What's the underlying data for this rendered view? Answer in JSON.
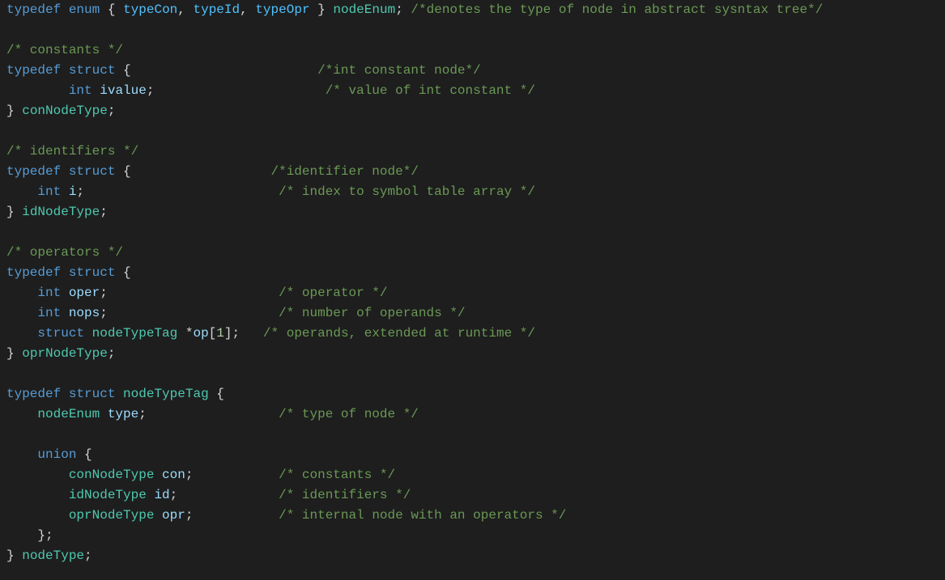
{
  "l0": {
    "kw1": "typedef",
    "kw2": "enum",
    "b1": "{",
    "e1": "typeCon",
    "c1": ",",
    "e2": "typeId",
    "c2": ",",
    "e3": "typeOpr",
    "b2": "}",
    "name": "nodeEnum",
    "sc": ";",
    "cm": "/*denotes the type of node in abstract sysntax tree*/"
  },
  "l1": "",
  "l2": {
    "cm": "/* constants */"
  },
  "l3": {
    "kw1": "typedef",
    "kw2": "struct",
    "b": "{",
    "cm": "/*int constant node*/"
  },
  "l4": {
    "kw": "int",
    "id": "ivalue",
    "sc": ";",
    "cm": "/* value of int constant */"
  },
  "l5": {
    "b": "}",
    "name": "conNodeType",
    "sc": ";"
  },
  "l6": "",
  "l7": {
    "cm": "/* identifiers */"
  },
  "l8": {
    "kw1": "typedef",
    "kw2": "struct",
    "b": "{",
    "cm": "/*identifier node*/"
  },
  "l9": {
    "kw": "int",
    "id": "i",
    "sc": ";",
    "cm": "/* index to symbol table array */"
  },
  "l10": {
    "b": "}",
    "name": "idNodeType",
    "sc": ";"
  },
  "l11": "",
  "l12": {
    "cm": "/* operators */"
  },
  "l13": {
    "kw1": "typedef",
    "kw2": "struct",
    "b": "{"
  },
  "l14": {
    "kw": "int",
    "id": "oper",
    "sc": ";",
    "cm": "/* operator */"
  },
  "l15": {
    "kw": "int",
    "id": "nops",
    "sc": ";",
    "cm": "/* number of operands */"
  },
  "l16": {
    "kw": "struct",
    "tag": "nodeTypeTag",
    "star": "*",
    "id": "op",
    "lb": "[",
    "n": "1",
    "rb": "]",
    "sc": ";",
    "cm": "/* operands, extended at runtime */"
  },
  "l17": {
    "b": "}",
    "name": "oprNodeType",
    "sc": ";"
  },
  "l18": "",
  "l19": {
    "kw1": "typedef",
    "kw2": "struct",
    "tag": "nodeTypeTag",
    "b": "{"
  },
  "l20": {
    "type": "nodeEnum",
    "id": "type",
    "sc": ";",
    "cm": "/* type of node */"
  },
  "l21": "",
  "l22": {
    "kw": "union",
    "b": "{"
  },
  "l23": {
    "type": "conNodeType",
    "id": "con",
    "sc": ";",
    "cm": "/* constants */"
  },
  "l24": {
    "type": "idNodeType",
    "id": "id",
    "sc": ";",
    "cm": "/* identifiers */"
  },
  "l25": {
    "type": "oprNodeType",
    "id": "opr",
    "sc": ";",
    "cm": "/* internal node with an operators */"
  },
  "l26": {
    "b": "}",
    "sc": ";"
  },
  "l27": {
    "b": "}",
    "name": "nodeType",
    "sc": ";"
  }
}
